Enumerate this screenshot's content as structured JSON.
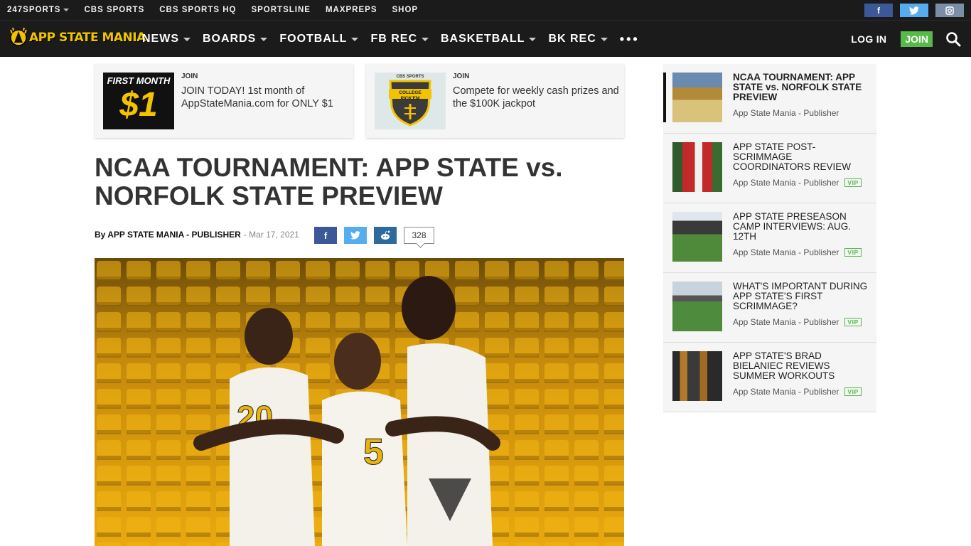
{
  "topbar": {
    "links": [
      "247SPORTS",
      "CBS SPORTS",
      "CBS SPORTS HQ",
      "SPORTSLINE",
      "MAXPREPS",
      "SHOP"
    ],
    "social": {
      "facebook": "f",
      "twitter": "t",
      "instagram": "ig"
    }
  },
  "nav": {
    "logo_text": "APP STATE MANIA",
    "items": [
      "NEWS",
      "BOARDS",
      "FOOTBALL",
      "FB REC",
      "BASKETBALL",
      "BK REC"
    ],
    "more": "•••",
    "login": "LOG IN",
    "join": "JOIN"
  },
  "promos": [
    {
      "kicker": "JOIN",
      "text": "JOIN TODAY! 1st month of AppStateMania.com for ONLY $1",
      "thumb_top": "FIRST MONTH",
      "thumb_big": "$1"
    },
    {
      "kicker": "JOIN",
      "text": "Compete for weekly cash prizes and the $100K jackpot",
      "thumb_top": "CBS SPORTS",
      "thumb_big": "COLLEGE PICK'EM"
    }
  ],
  "article": {
    "headline": "NCAA TOURNAMENT: APP STATE vs. NORFOLK STATE PREVIEW",
    "author": "By APP STATE MANIA - PUBLISHER",
    "date": "- Mar 17, 2021",
    "comment_count": "328"
  },
  "sidebar": [
    {
      "title": "NCAA TOURNAMENT: APP STATE vs. NORFOLK STATE PREVIEW",
      "meta": "App State Mania - Publisher",
      "vip": ""
    },
    {
      "title": "APP STATE POST-SCRIMMAGE COORDINATORS REVIEW",
      "meta": "App State Mania - Publisher",
      "vip": "VIP"
    },
    {
      "title": "APP STATE PRESEASON CAMP INTERVIEWS: AUG. 12TH",
      "meta": "App State Mania - Publisher",
      "vip": "VIP"
    },
    {
      "title": "WHAT'S IMPORTANT DURING APP STATE'S FIRST SCRIMMAGE?",
      "meta": "App State Mania - Publisher",
      "vip": "VIP"
    },
    {
      "title": "APP STATE'S BRAD BIELANIEC REVIEWS SUMMER WORKOUTS",
      "meta": "App State Mania - Publisher",
      "vip": "VIP"
    }
  ],
  "colors": {
    "bar": "#1b1b1b",
    "gold": "#f2c300",
    "join_green": "#57b94a",
    "facebook": "#3b5998",
    "twitter": "#55acee"
  }
}
